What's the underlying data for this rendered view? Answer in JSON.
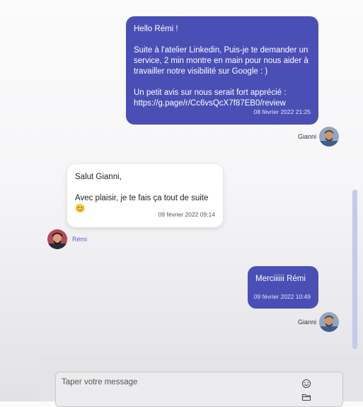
{
  "messages": [
    {
      "text": "Hello Rémi !\n\nSuite à l'atelier Linkedin, Puis-je te demander un service, 2 min montre en main pour nous aider à travailler notre visibilité sur Google : )\n\nUn petit avis sur nous serait fort apprécié :\nhttps://g.page/r/Cc6vsQcX7f87EB0/review",
      "time": "08 février 2022 21:25",
      "author": "Gianni"
    },
    {
      "text": "Salut Gianni,\n\nAvec plaisir, je te fais ça tout de suite 😊",
      "time": "09 février 2022 09:14",
      "author": "Rémi"
    },
    {
      "text": "Merciiiiii Rémi",
      "time": "09 février 2022 10:49",
      "author": "Gianni"
    }
  ],
  "composer": {
    "placeholder": "Taper votre message",
    "emoji_icon": "emoji-icon",
    "attach_icon": "folder-icon"
  },
  "colors": {
    "sent_bubble": "#4a4fb5",
    "received_bubble": "#ffffff",
    "remi_name": "#6a5acd"
  }
}
